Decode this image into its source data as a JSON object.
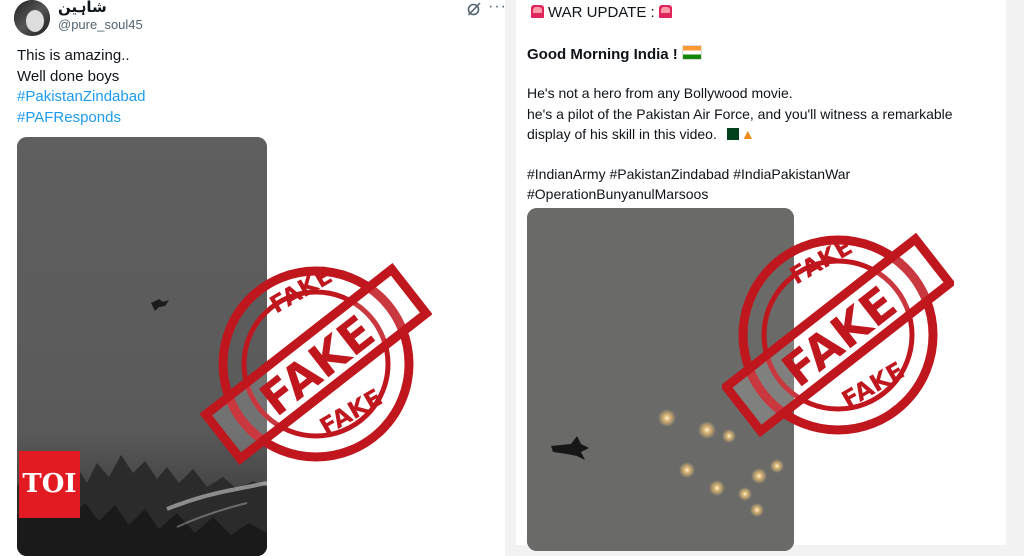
{
  "left_post": {
    "display_name": "شاہین",
    "handle": "@pure_soul45",
    "lines": [
      "This is amazing..",
      "Well done boys"
    ],
    "hashtags": [
      "#PakistanZindabad",
      "#PAFResponds"
    ]
  },
  "right_post": {
    "header": "WAR UPDATE :",
    "greeting": "Good Morning India !",
    "body_lines": [
      "He's not a hero from any Bollywood movie.",
      "he's a pilot of the Pakistan Air Force, and you'll witness a remarkable",
      "display of his skill in this video."
    ],
    "hashtag_line1": "#IndianArmy #PakistanZindabad #IndiaPakistanWar",
    "hashtag_line2": "#OperationBunyanulMarsoos"
  },
  "stamp": {
    "text": "FAKE",
    "color": "#c0161e"
  },
  "brand": {
    "logo_text": "TOI",
    "color": "#e21b22"
  },
  "colors": {
    "hashtag": "#1d9bf0",
    "muted": "#536471"
  }
}
